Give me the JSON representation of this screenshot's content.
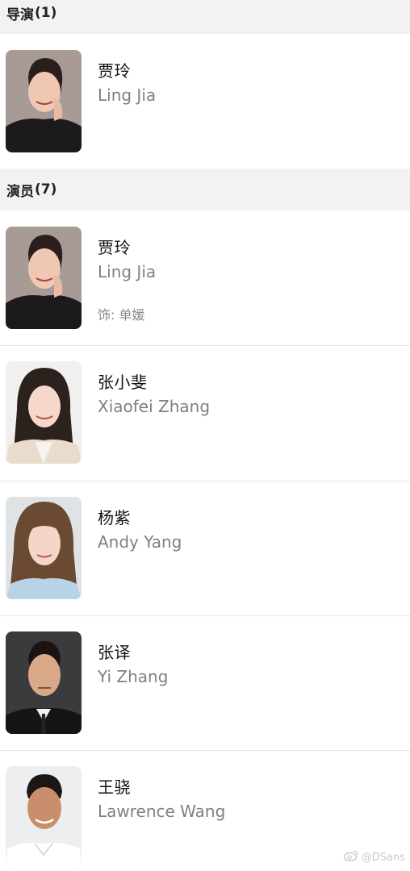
{
  "sections": {
    "director": {
      "title": "导演",
      "count": "(1)"
    },
    "cast": {
      "title": "演员",
      "count": "(7)"
    }
  },
  "director": {
    "name_cn": "贾玲",
    "name_en": "Ling Jia",
    "avatar_icon": "person-photo-icon"
  },
  "cast": [
    {
      "name_cn": "贾玲",
      "name_en": "Ling Jia",
      "role": "饰: 单媛"
    },
    {
      "name_cn": "张小斐",
      "name_en": "Xiaofei Zhang"
    },
    {
      "name_cn": "杨紫",
      "name_en": "Andy Yang"
    },
    {
      "name_cn": "张译",
      "name_en": "Yi Zhang"
    },
    {
      "name_cn": "王骁",
      "name_en": "Lawrence Wang"
    }
  ],
  "watermark": {
    "icon": "weibo-icon",
    "text": "@DSans"
  },
  "colors": {
    "header_bg": "#f2f2f2",
    "secondary_text": "#808080"
  }
}
